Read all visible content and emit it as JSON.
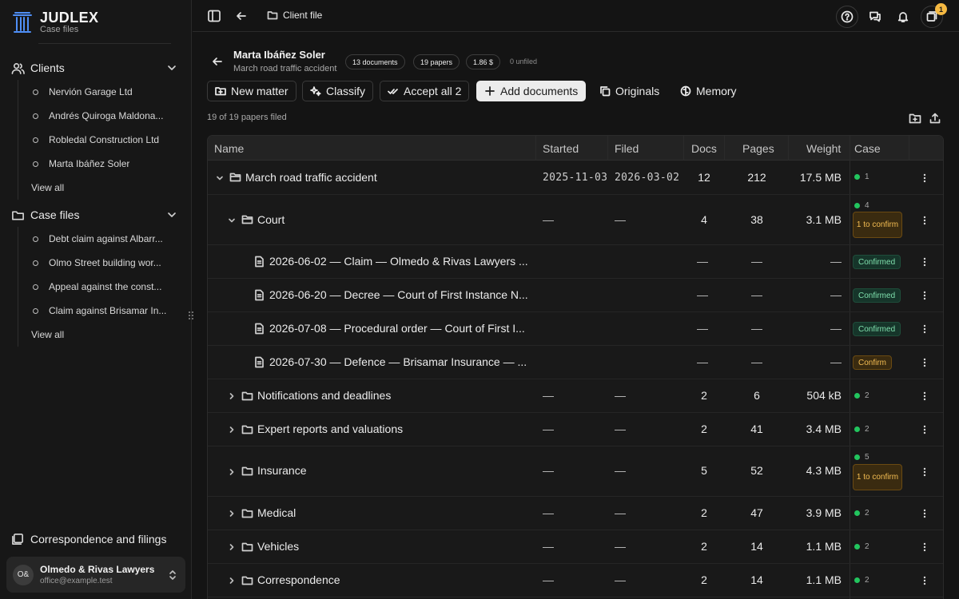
{
  "brand": {
    "name": "JUDLEX",
    "subtitle": "Case files"
  },
  "sidebar": {
    "clients": {
      "title": "Clients",
      "items": [
        "Nervión Garage Ltd",
        "Andrés Quiroga Maldona...",
        "Robledal Construction Ltd",
        "Marta Ibáñez Soler"
      ],
      "view_all": "View all"
    },
    "case_files": {
      "title": "Case files",
      "items": [
        "Debt claim against Albarr...",
        "Olmo Street building wor...",
        "Appeal against the const...",
        "Claim against Brisamar In..."
      ],
      "view_all": "View all"
    },
    "correspondence": "Correspondence and filings",
    "user": {
      "initials": "O&",
      "name": "Olmedo & Rivas Lawyers",
      "email": "office@example.test"
    }
  },
  "topbar": {
    "crumb": "Client file",
    "notifications_count": "1"
  },
  "client": {
    "name": "Marta Ibáñez Soler",
    "matter": "March road traffic accident",
    "chips": [
      "13 documents",
      "19 papers",
      "1.86 $"
    ],
    "unfiled": "0 unfiled"
  },
  "actions": {
    "new_matter": "New matter",
    "classify": "Classify",
    "accept_all": "Accept all 2",
    "add_documents": "Add documents",
    "originals": "Originals",
    "memory": "Memory"
  },
  "filed_summary": "19 of 19 papers filed",
  "table": {
    "columns": {
      "name": "Name",
      "started": "Started",
      "filed": "Filed",
      "docs": "Docs",
      "pages": "Pages",
      "weight": "Weight",
      "case": "Case"
    },
    "rows": [
      {
        "name": "March road traffic accident",
        "started": "2025-11-03",
        "filed": "2026-03-02",
        "docs": "12",
        "pages": "212",
        "weight": "17.5 MB",
        "case_count": "1",
        "case_pill": ""
      },
      {
        "name": "Court",
        "started": "—",
        "filed": "—",
        "docs": "4",
        "pages": "38",
        "weight": "3.1 MB",
        "case_count": "4",
        "case_pill": "1 to confirm"
      },
      {
        "name": "2026-06-02 — Claim — Olmedo & Rivas Lawyers ...",
        "started": "",
        "filed": "",
        "docs": "",
        "pages": "—",
        "weight": "—",
        "dash_started": "—",
        "case_pill": "Confirmed"
      },
      {
        "name": "2026-06-20 — Decree — Court of First Instance N...",
        "dash_started": "—",
        "pages": "—",
        "weight": "—",
        "case_pill": "Confirmed"
      },
      {
        "name": "2026-07-08 — Procedural order — Court of First I...",
        "dash_started": "—",
        "pages": "—",
        "weight": "—",
        "case_pill": "Confirmed"
      },
      {
        "name": "2026-07-30 — Defence — Brisamar Insurance — ...",
        "dash_started": "—",
        "pages": "—",
        "weight": "—",
        "case_pill": "Confirm"
      },
      {
        "name": "Notifications and deadlines",
        "started": "—",
        "filed": "—",
        "docs": "2",
        "pages": "6",
        "weight": "504 kB",
        "case_count": "2"
      },
      {
        "name": "Expert reports and valuations",
        "started": "—",
        "filed": "—",
        "docs": "2",
        "pages": "41",
        "weight": "3.4 MB",
        "case_count": "2"
      },
      {
        "name": "Insurance",
        "started": "—",
        "filed": "—",
        "docs": "5",
        "pages": "52",
        "weight": "4.3 MB",
        "case_count": "5",
        "case_pill": "1 to confirm"
      },
      {
        "name": "Medical",
        "started": "—",
        "filed": "—",
        "docs": "2",
        "pages": "47",
        "weight": "3.9 MB",
        "case_count": "2"
      },
      {
        "name": "Vehicles",
        "started": "—",
        "filed": "—",
        "docs": "2",
        "pages": "14",
        "weight": "1.1 MB",
        "case_count": "2"
      },
      {
        "name": "Correspondence",
        "started": "—",
        "filed": "—",
        "docs": "2",
        "pages": "14",
        "weight": "1.1 MB",
        "case_count": "2"
      }
    ]
  },
  "colors": {
    "accent": "#4f8ff7",
    "success": "#22c55e",
    "warning": "#f3bc52",
    "badge": "#f5b942"
  }
}
